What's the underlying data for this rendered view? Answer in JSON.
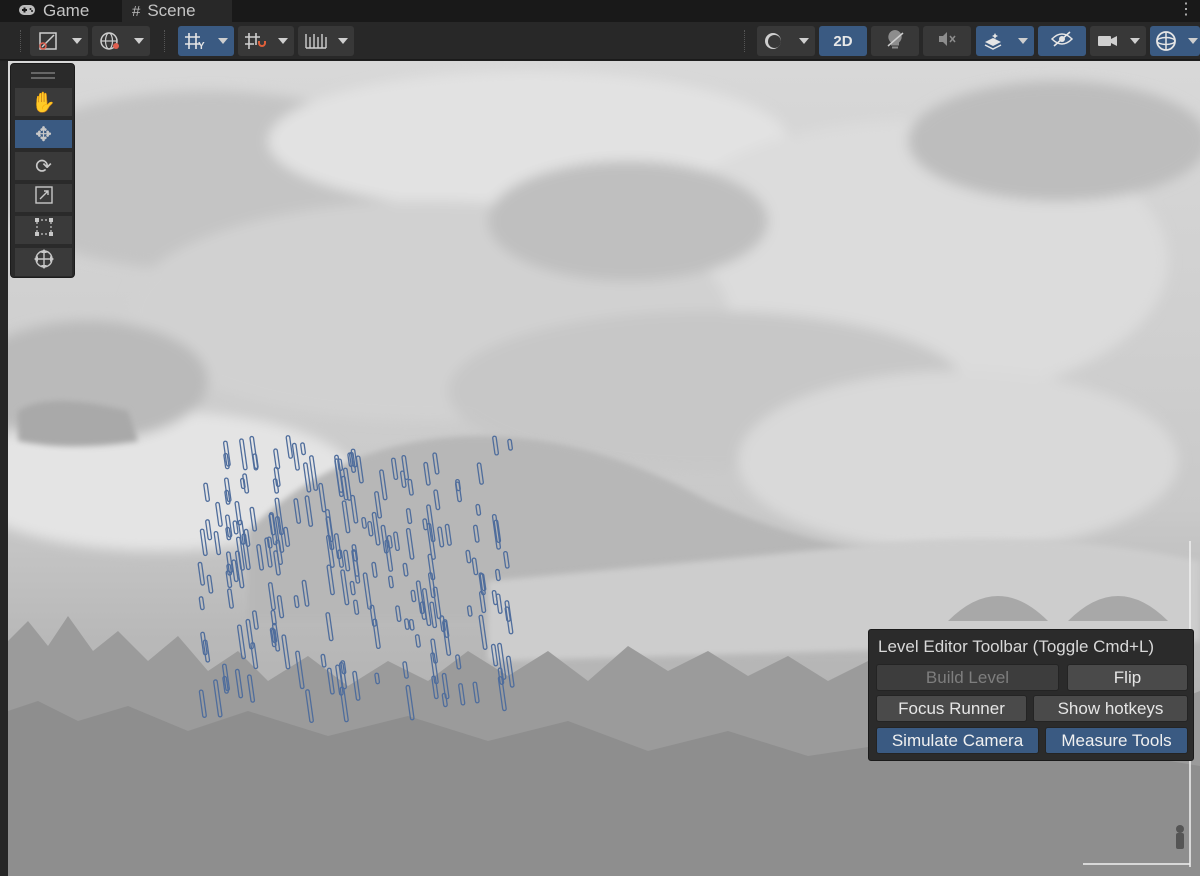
{
  "tabs": [
    {
      "label": "Game",
      "icon": "gamepad-icon"
    },
    {
      "label": "Scene",
      "icon": "hash-icon"
    }
  ],
  "toolbar": {
    "mode_2d_label": "2D",
    "accent": "#3a5a82"
  },
  "tools": [
    {
      "name": "hand-tool",
      "glyph": "✋"
    },
    {
      "name": "move-tool",
      "glyph": "✥",
      "active": true
    },
    {
      "name": "rotate-tool",
      "glyph": "⟳"
    },
    {
      "name": "scale-tool",
      "glyph": "⤢"
    },
    {
      "name": "rect-tool",
      "glyph": "⬚"
    },
    {
      "name": "transform-tool",
      "glyph": "⊕"
    }
  ],
  "level_editor": {
    "title": "Level Editor Toolbar (Toggle Cmd+L)",
    "buttons": {
      "build_level": "Build Level",
      "flip": "Flip",
      "focus_runner": "Focus Runner",
      "show_hotkeys": "Show hotkeys",
      "simulate_camera": "Simulate Camera",
      "measure_tools": "Measure Tools"
    },
    "state": {
      "build_level": "disabled",
      "simulate_camera": "active",
      "measure_tools": "active"
    }
  },
  "viewport": {
    "streak_color": "#4f6d9c"
  }
}
